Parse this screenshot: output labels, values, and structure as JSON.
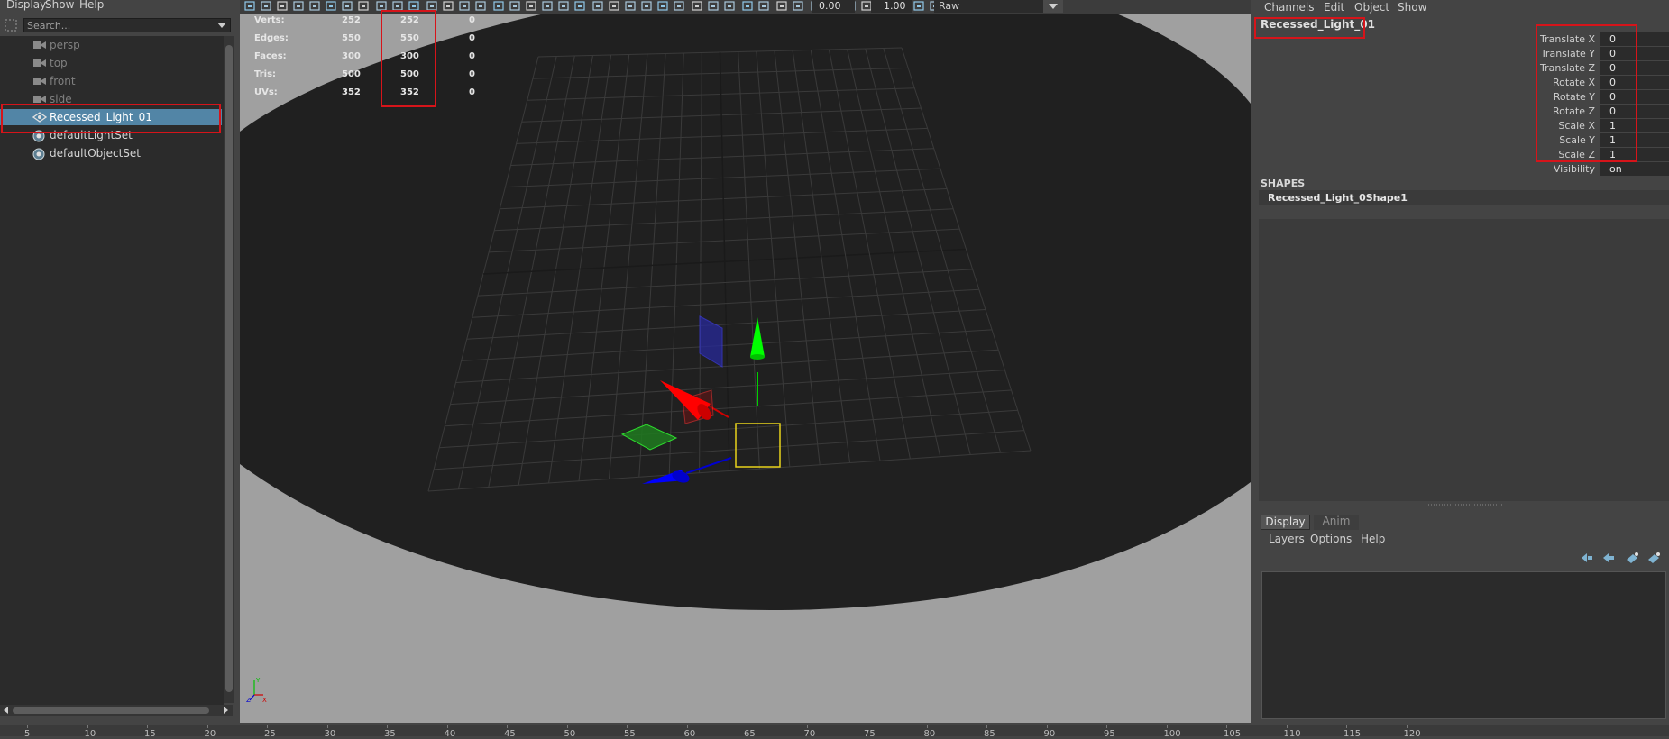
{
  "outliner": {
    "menu": [
      "Display",
      "Show",
      "Help"
    ],
    "search_placeholder": "Search...",
    "items": [
      {
        "label": "persp",
        "type": "camera"
      },
      {
        "label": "top",
        "type": "camera"
      },
      {
        "label": "front",
        "type": "camera"
      },
      {
        "label": "side",
        "type": "camera"
      },
      {
        "label": "Recessed_Light_01",
        "type": "mesh",
        "selected": true
      },
      {
        "label": "defaultLightSet",
        "type": "set"
      },
      {
        "label": "defaultObjectSet",
        "type": "set"
      }
    ]
  },
  "viewport_toolbar": {
    "field_a": "0.00",
    "field_b": "1.00",
    "color_space": "Raw"
  },
  "hud": {
    "rows": [
      {
        "label": "Verts:",
        "c1": "252",
        "c2": "252",
        "c3": "0"
      },
      {
        "label": "Edges:",
        "c1": "550",
        "c2": "550",
        "c3": "0"
      },
      {
        "label": "Faces:",
        "c1": "300",
        "c2": "300",
        "c3": "0"
      },
      {
        "label": "Tris:",
        "c1": "500",
        "c2": "500",
        "c3": "0"
      },
      {
        "label": "UVs:",
        "c1": "352",
        "c2": "352",
        "c3": "0"
      }
    ]
  },
  "channel_box": {
    "menu": [
      "Channels",
      "Edit",
      "Object",
      "Show"
    ],
    "object_name": "Recessed_Light_01",
    "attributes": [
      {
        "label": "Translate X",
        "value": "0"
      },
      {
        "label": "Translate Y",
        "value": "0"
      },
      {
        "label": "Translate Z",
        "value": "0"
      },
      {
        "label": "Rotate X",
        "value": "0"
      },
      {
        "label": "Rotate Y",
        "value": "0"
      },
      {
        "label": "Rotate Z",
        "value": "0"
      },
      {
        "label": "Scale X",
        "value": "1"
      },
      {
        "label": "Scale Y",
        "value": "1"
      },
      {
        "label": "Scale Z",
        "value": "1"
      },
      {
        "label": "Visibility",
        "value": "on"
      }
    ],
    "shapes_title": "SHAPES",
    "shape_name": "Recessed_Light_0Shape1"
  },
  "layer_editor": {
    "tabs": [
      "Display",
      "Anim"
    ],
    "active_tab": "Display",
    "menu": [
      "Layers",
      "Options",
      "Help"
    ]
  },
  "time_slider": {
    "ticks": [
      "5",
      "10",
      "15",
      "20",
      "25",
      "30",
      "35",
      "40",
      "45",
      "50",
      "55",
      "60",
      "65",
      "70",
      "75",
      "80",
      "85",
      "90",
      "95",
      "100",
      "105",
      "110",
      "115",
      "120"
    ]
  },
  "colors": {
    "selection": "#5285a6",
    "annotation_red": "#d6141a",
    "viewport_bg": "#a0a0a0",
    "ground": "#202020",
    "axis_x": "#ff0000",
    "axis_y": "#00ff00",
    "axis_z": "#0000ff",
    "selection_box": "#e8d21a"
  }
}
